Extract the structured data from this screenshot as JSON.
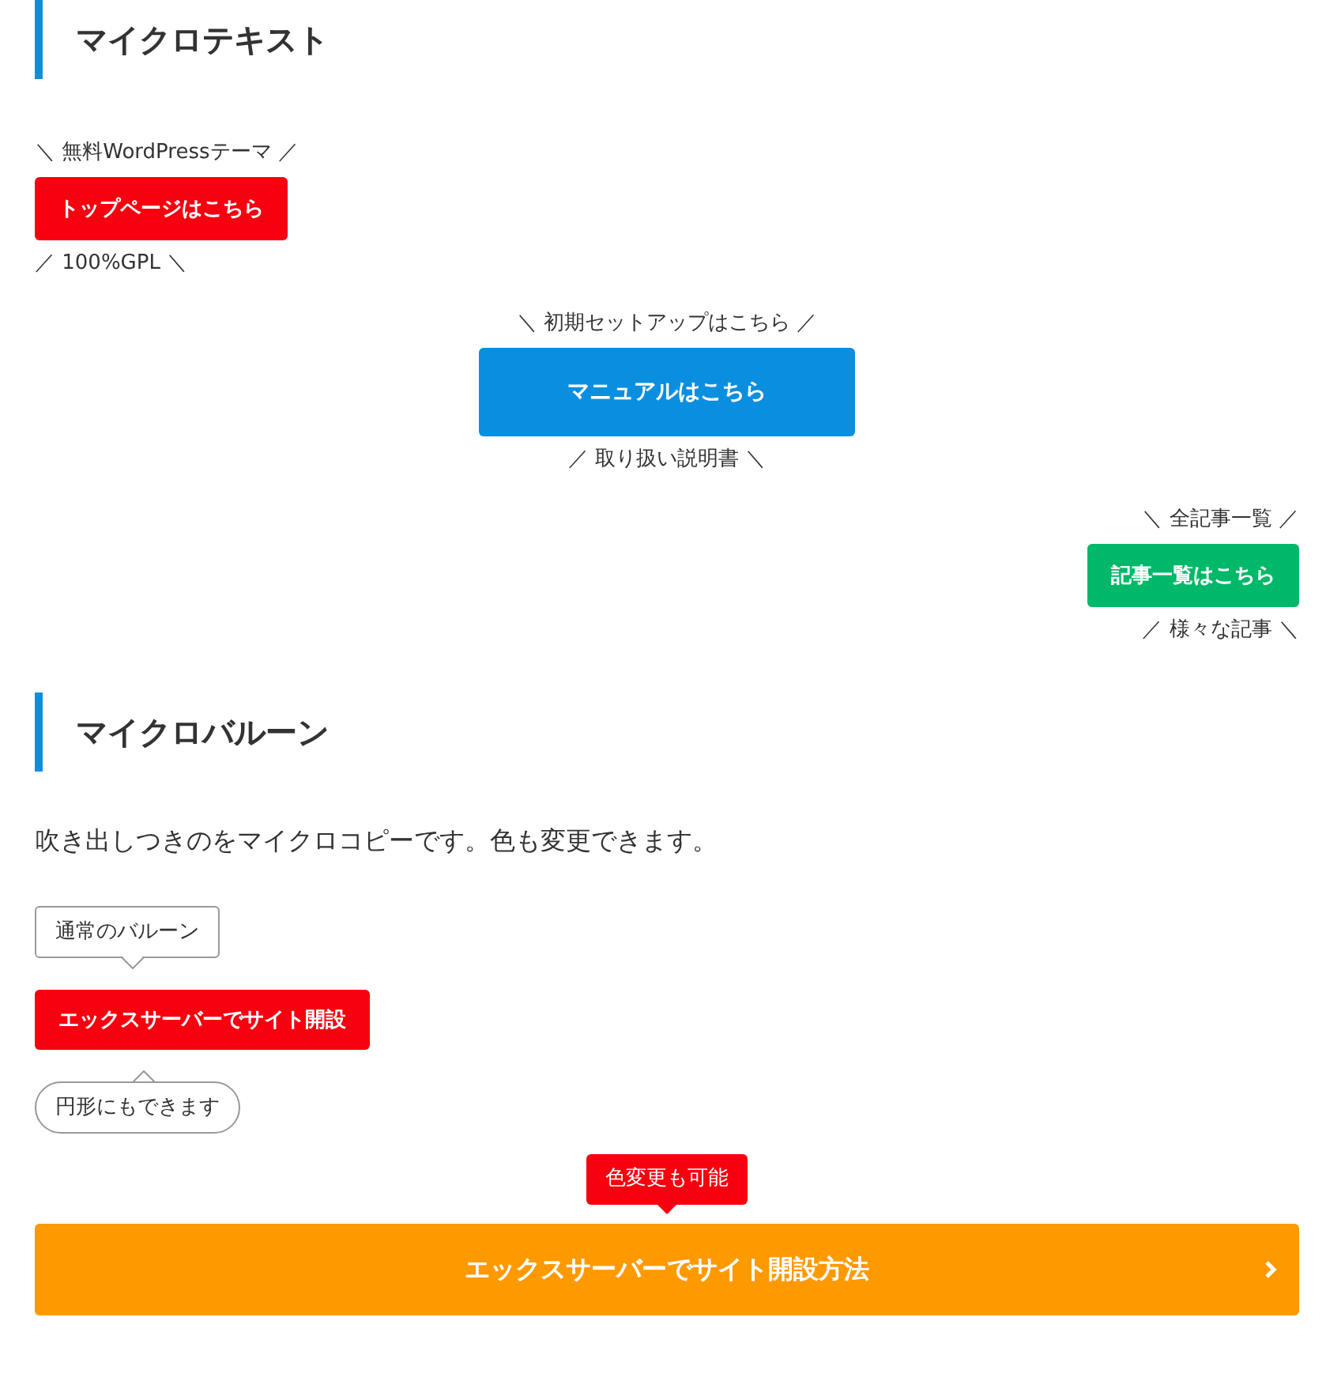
{
  "sections": [
    {
      "heading": "マイクロテキスト",
      "blocks": [
        {
          "kind": "left",
          "top": "＼ 無料WordPressテーマ ／",
          "button": {
            "label": "トップページはこちら",
            "color": "#f7000f",
            "kind": "small"
          },
          "bottom": "／ 100%GPL ＼"
        },
        {
          "kind": "center",
          "top": "＼ 初期セットアップはこちら ／",
          "button": {
            "label": "マニュアルはこちら",
            "color": "#0a8fe0",
            "kind": "large"
          },
          "bottom": "／ 取り扱い説明書 ＼"
        },
        {
          "kind": "right",
          "top": "＼ 全記事一覧 ／",
          "button": {
            "label": "記事一覧はこちら",
            "color": "#00b869",
            "kind": "small"
          },
          "bottom": "／ 様々な記事 ＼"
        }
      ]
    },
    {
      "heading": "マイクロバルーン",
      "paragraph": "吹き出しつきのをマイクロコピーです。色も変更できます。",
      "blocks": [
        {
          "kind": "balloon",
          "text": "通常のバルーン"
        },
        {
          "kind": "button",
          "label": "エックスサーバーでサイト開設",
          "color": "#f7000f"
        },
        {
          "kind": "roundballoon",
          "text": "円形にもできます"
        },
        {
          "kind": "wide",
          "balloon": {
            "text": "色変更も可能",
            "color": "#f7000f"
          },
          "label": "エックスサーバーでサイト開設方法",
          "color": "#ff9900"
        }
      ]
    }
  ]
}
